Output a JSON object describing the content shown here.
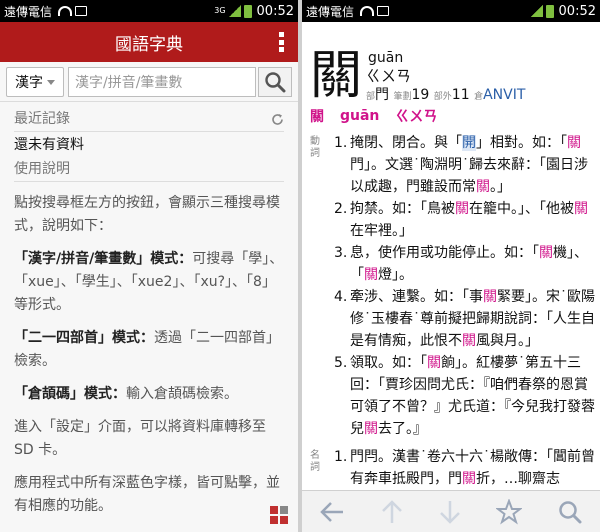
{
  "status_left": {
    "carrier": "遠傳電信",
    "net": "3G",
    "time": "00:52"
  },
  "status_right": {
    "carrier": "遠傳電信",
    "time": "00:52"
  },
  "left": {
    "app_title": "國語字典",
    "mode_label": "漢字",
    "search_placeholder": "漢字/拼音/筆畫數",
    "recent_title": "最近記錄",
    "recent_empty": "還未有資料",
    "help_title": "使用說明",
    "help_intro": "點按搜尋框左方的按鈕，會顯示三種搜尋模式，說明如下：",
    "help_mode1_title": "「漢字/拼音/筆畫數」模式：",
    "help_mode1_text": "可搜尋「學」、「xue」、「學生」、「xue2」、「xu?」、「8」等形式。",
    "help_mode2_title": "「二一四部首」模式：",
    "help_mode2_text": "透過「二一四部首」檢索。",
    "help_mode3_title": "「倉頡碼」模式：",
    "help_mode3_text": "輸入倉頡碼檢索。",
    "help_settings": "進入「設定」介面，可以將資料庫轉移至 SD 卡。",
    "help_blue": "應用程式中所有深藍色字樣，皆可點擊，並有相應的功能。"
  },
  "right": {
    "char": "關",
    "pinyin": "guān",
    "zhuyin": "ㄍㄨㄢ",
    "radical_label": "部",
    "radical": "門",
    "strokes_label": "筆劃",
    "strokes": "19",
    "outer_label": "部外",
    "outer": "11",
    "cangjie_label": "倉",
    "cangjie": "ANVIT",
    "pron_char": "關",
    "pron_pinyin": "guān",
    "pron_zhuyin": "ㄍㄨㄢ",
    "verb_label": "動詞",
    "noun_label": "名詞",
    "defs": [
      {
        "num": "1.",
        "p1": "掩閉、閉合。與「",
        "key": "開",
        "p2": "」相對。如：「",
        "k2": "關",
        "p3": "門」。文選˙陶淵明˙歸去來辭：「園日涉以成趣，門雖設而常",
        "k3": "關",
        "p4": "。」"
      },
      {
        "num": "2.",
        "p1": "拘禁。如：「鳥被",
        "k1": "關",
        "p2": "在籠中。」、「他被",
        "k2": "關",
        "p3": "在牢裡。」"
      },
      {
        "num": "3.",
        "p1": "息，使作用或功能停止。如：「",
        "k1": "關",
        "p2": "機」、「",
        "k2": "關",
        "p3": "燈」。"
      },
      {
        "num": "4.",
        "p1": "牽涉、連繫。如：「事",
        "k1": "關",
        "p2": "緊要」。宋˙歐陽修˙玉樓春˙尊前擬把歸期說詞：「人生自是有情痴，此恨不",
        "k2": "關",
        "p3": "風與月。」"
      },
      {
        "num": "5.",
        "p1": "領取。如：「",
        "k1": "關",
        "p2": "餉」。紅樓夢˙第五十三回：「賈珍因問尤氏：『咱們春祭的恩賞可領了不曾？』尤氏道：『今兒我打發蓉兒",
        "k2": "關",
        "p3": "去了。』"
      }
    ],
    "noun_def": {
      "num": "1.",
      "p1": "門閂。漢書˙卷六十六˙楊敞傳：「閶前曾有奔車抵殿門，門",
      "k1": "關",
      "p2": "折，…聊齋志"
    }
  }
}
